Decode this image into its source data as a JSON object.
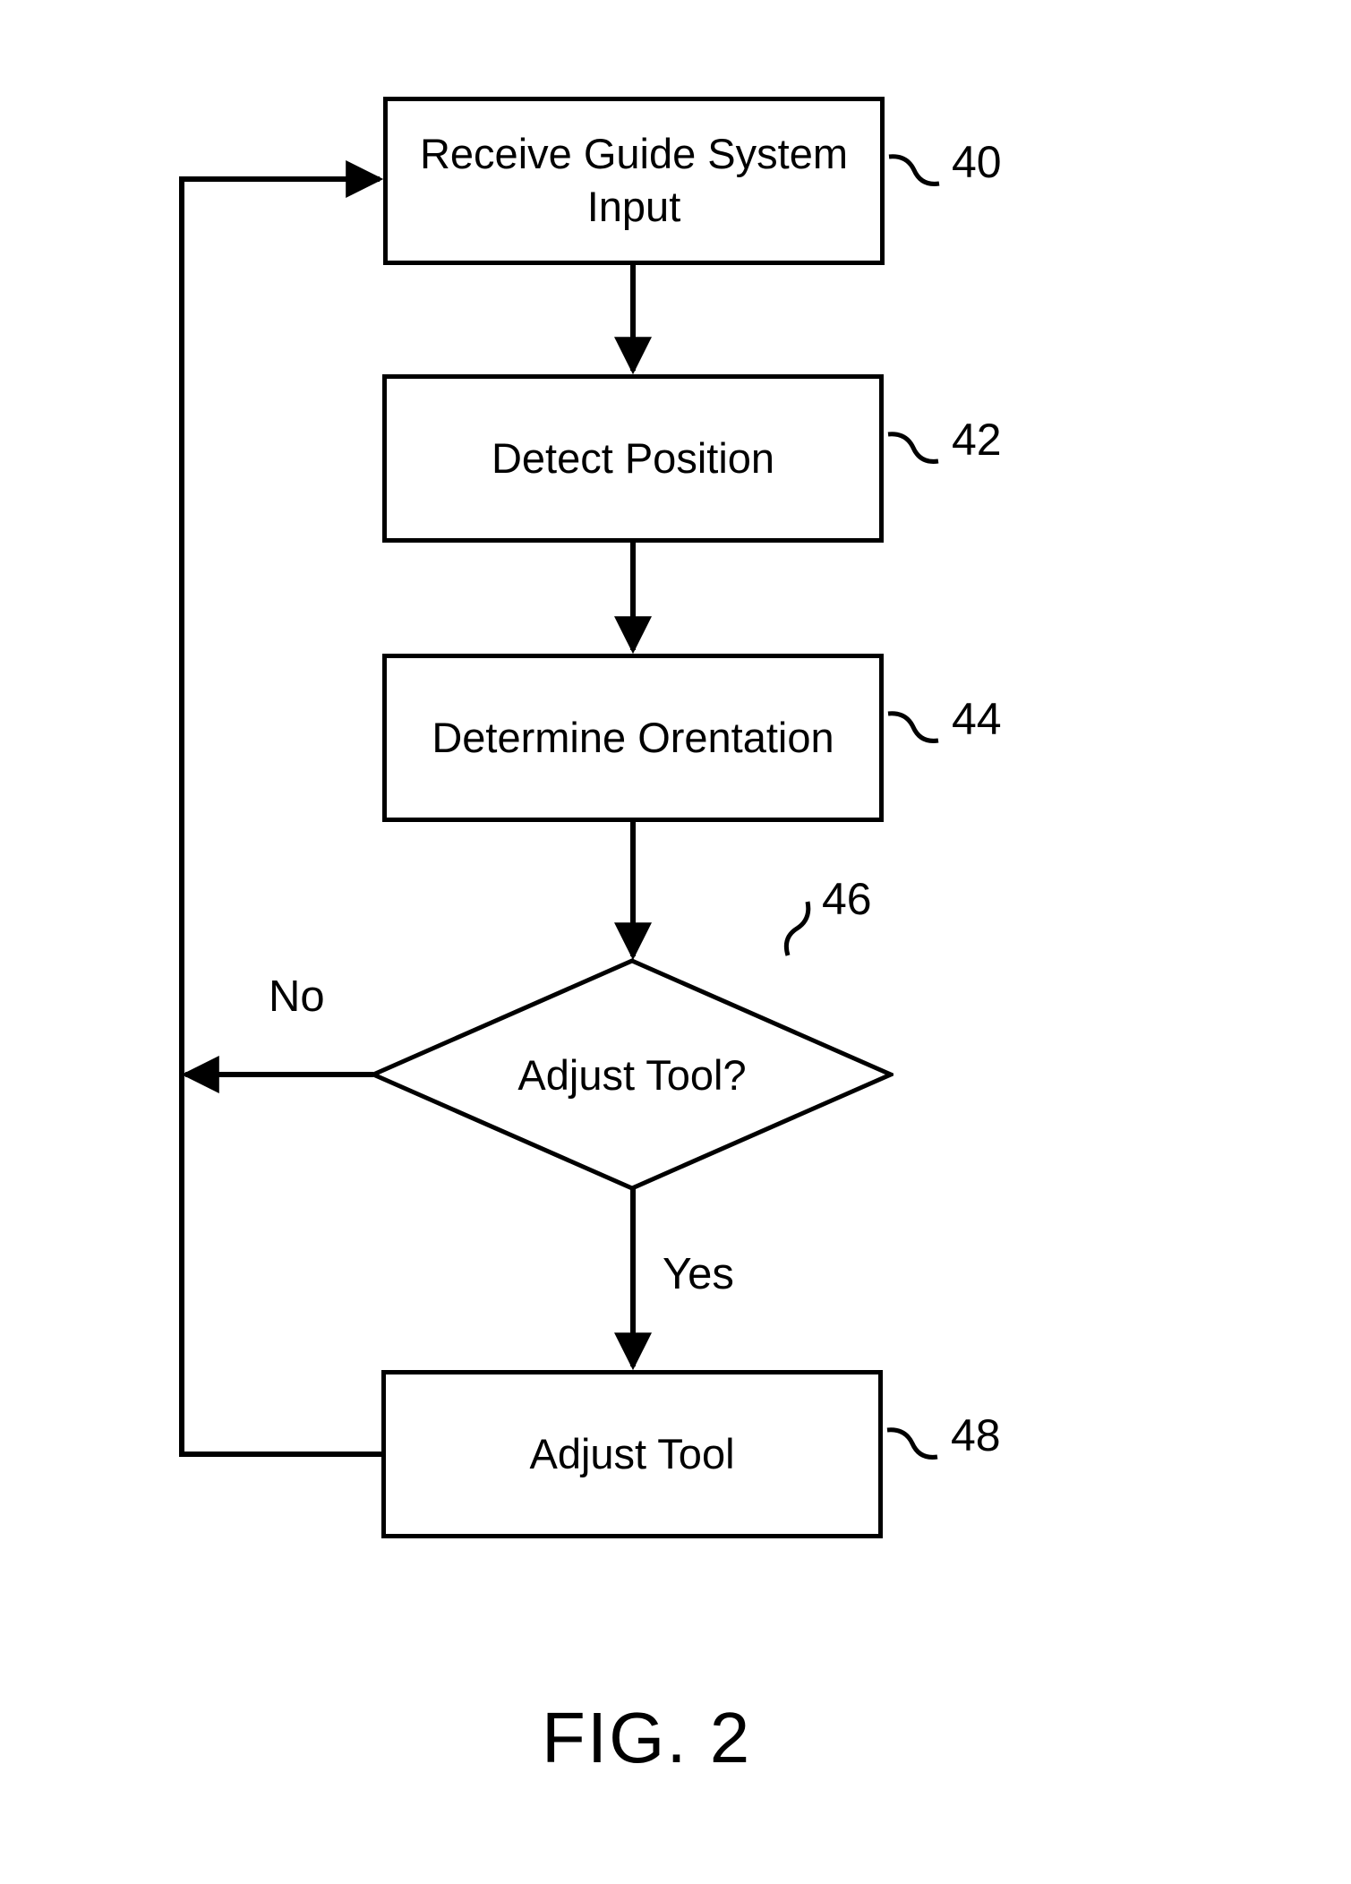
{
  "nodes": {
    "receive_input": {
      "text": "Receive Guide System\nInput",
      "ref": "40"
    },
    "detect_position": {
      "text": "Detect Position",
      "ref": "42"
    },
    "determine_orientation": {
      "text": "Determine Orentation",
      "ref": "44"
    },
    "adjust_tool_decision": {
      "text": "Adjust Tool?",
      "ref": "46"
    },
    "adjust_tool": {
      "text": "Adjust Tool",
      "ref": "48"
    }
  },
  "edges": {
    "decision_no": "No",
    "decision_yes": "Yes"
  },
  "figure_label": "FIG. 2"
}
